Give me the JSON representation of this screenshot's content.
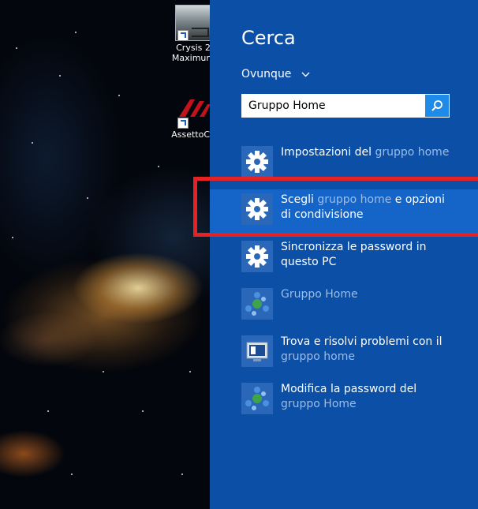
{
  "desktop": {
    "icons": [
      {
        "label_line1": "Crysis 2",
        "label_line2": "Maximum",
        "icon": "crysis-game-icon"
      },
      {
        "label_line1": "AssettoCo",
        "icon": "assetto-corsa-game-icon"
      }
    ]
  },
  "search_panel": {
    "title": "Cerca",
    "scope": "Ovunque",
    "query": "Gruppo Home",
    "results": [
      {
        "icon": "gear-icon",
        "parts": [
          "Impostazioni del ",
          "gruppo home",
          ""
        ]
      },
      {
        "icon": "gear-icon",
        "parts": [
          "Scegli ",
          "gruppo home",
          " e opzioni di condivisione"
        ],
        "selected": true
      },
      {
        "icon": "gear-icon",
        "parts": [
          "Sincronizza le password in questo PC",
          "",
          ""
        ]
      },
      {
        "icon": "homegroup-icon",
        "parts": [
          "",
          "Gruppo Home",
          ""
        ]
      },
      {
        "icon": "troubleshoot-icon",
        "parts": [
          "Trova e risolvi problemi con il ",
          "gruppo home",
          ""
        ]
      },
      {
        "icon": "homegroup-icon",
        "parts": [
          "Modifica la password del ",
          "gruppo Home",
          ""
        ]
      }
    ]
  },
  "colors": {
    "panel_bg": "#0b4fa7",
    "selected_bg": "#1565c8",
    "highlight_text": "#9bbde8",
    "annotation_red": "#e52224",
    "search_button": "#1e8be8"
  }
}
